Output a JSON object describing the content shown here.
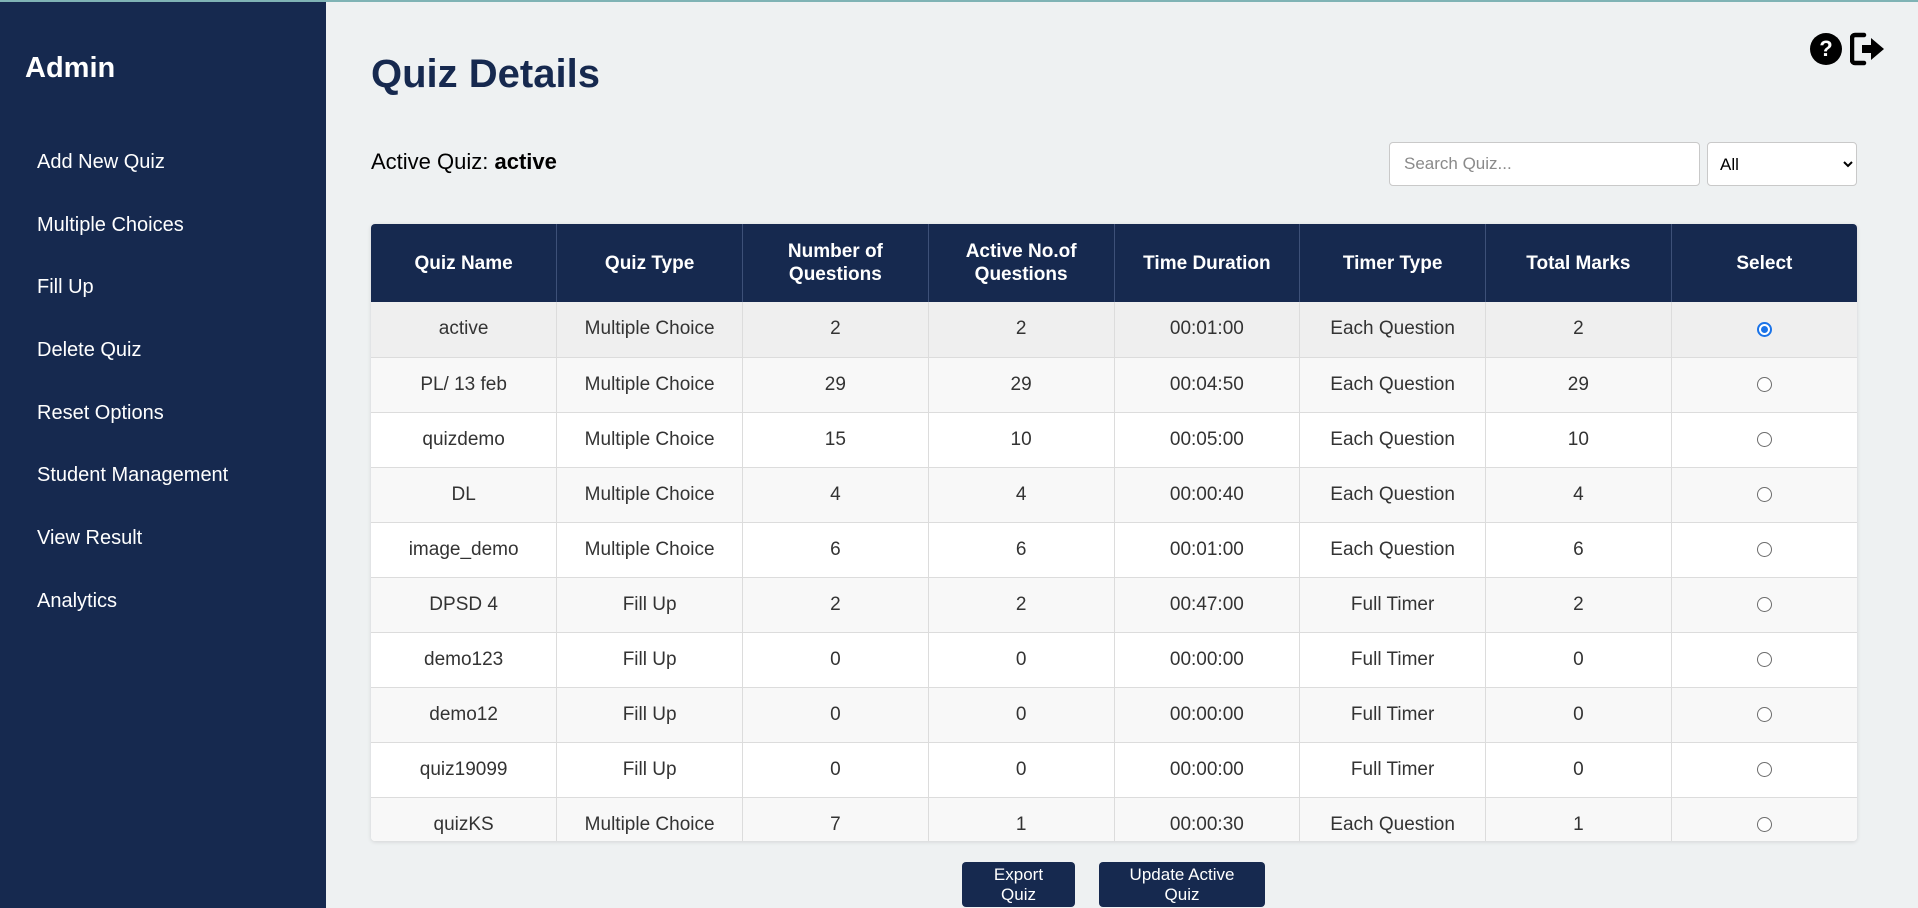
{
  "sidebar": {
    "brand": "Admin",
    "items": [
      {
        "label": "Add New Quiz"
      },
      {
        "label": "Multiple Choices"
      },
      {
        "label": "Fill Up"
      },
      {
        "label": "Delete Quiz"
      },
      {
        "label": "Reset Options"
      },
      {
        "label": "Student Management"
      },
      {
        "label": "View Result"
      },
      {
        "label": "Analytics"
      }
    ]
  },
  "header": {
    "title": "Quiz Details",
    "help_icon_glyph": "?",
    "icons": [
      "help-icon",
      "logout-icon"
    ]
  },
  "active_quiz": {
    "label": "Active Quiz: ",
    "value": "active"
  },
  "search": {
    "placeholder": "Search Quiz...",
    "value": ""
  },
  "filter": {
    "selected": "All"
  },
  "table": {
    "columns": [
      {
        "label": "Quiz Name"
      },
      {
        "label": "Quiz Type"
      },
      {
        "label": "Number of Questions"
      },
      {
        "label": "Active No.of Questions"
      },
      {
        "label": "Time Duration"
      },
      {
        "label": "Timer Type"
      },
      {
        "label": "Total Marks"
      },
      {
        "label": "Select"
      }
    ],
    "rows": [
      {
        "name": "active",
        "type": "Multiple Choice",
        "num_questions": "2",
        "active_questions": "2",
        "duration": "00:01:00",
        "timer": "Each Question",
        "marks": "2",
        "selected": true
      },
      {
        "name": "PL/ 13 feb",
        "type": "Multiple Choice",
        "num_questions": "29",
        "active_questions": "29",
        "duration": "00:04:50",
        "timer": "Each Question",
        "marks": "29",
        "selected": false
      },
      {
        "name": "quizdemo",
        "type": "Multiple Choice",
        "num_questions": "15",
        "active_questions": "10",
        "duration": "00:05:00",
        "timer": "Each Question",
        "marks": "10",
        "selected": false
      },
      {
        "name": "DL",
        "type": "Multiple Choice",
        "num_questions": "4",
        "active_questions": "4",
        "duration": "00:00:40",
        "timer": "Each Question",
        "marks": "4",
        "selected": false
      },
      {
        "name": "image_demo",
        "type": "Multiple Choice",
        "num_questions": "6",
        "active_questions": "6",
        "duration": "00:01:00",
        "timer": "Each Question",
        "marks": "6",
        "selected": false
      },
      {
        "name": "DPSD 4",
        "type": "Fill Up",
        "num_questions": "2",
        "active_questions": "2",
        "duration": "00:47:00",
        "timer": "Full Timer",
        "marks": "2",
        "selected": false
      },
      {
        "name": "demo123",
        "type": "Fill Up",
        "num_questions": "0",
        "active_questions": "0",
        "duration": "00:00:00",
        "timer": "Full Timer",
        "marks": "0",
        "selected": false
      },
      {
        "name": "demo12",
        "type": "Fill Up",
        "num_questions": "0",
        "active_questions": "0",
        "duration": "00:00:00",
        "timer": "Full Timer",
        "marks": "0",
        "selected": false
      },
      {
        "name": "quiz19099",
        "type": "Fill Up",
        "num_questions": "0",
        "active_questions": "0",
        "duration": "00:00:00",
        "timer": "Full Timer",
        "marks": "0",
        "selected": false
      },
      {
        "name": "quizKS",
        "type": "Multiple Choice",
        "num_questions": "7",
        "active_questions": "1",
        "duration": "00:00:30",
        "timer": "Each Question",
        "marks": "1",
        "selected": false
      }
    ]
  },
  "buttons": {
    "export": "Export Quiz",
    "update": "Update Active Quiz"
  },
  "colors": {
    "navy": "#16294f",
    "background": "#eef1f2",
    "radio_selected": "#1a73e8"
  }
}
